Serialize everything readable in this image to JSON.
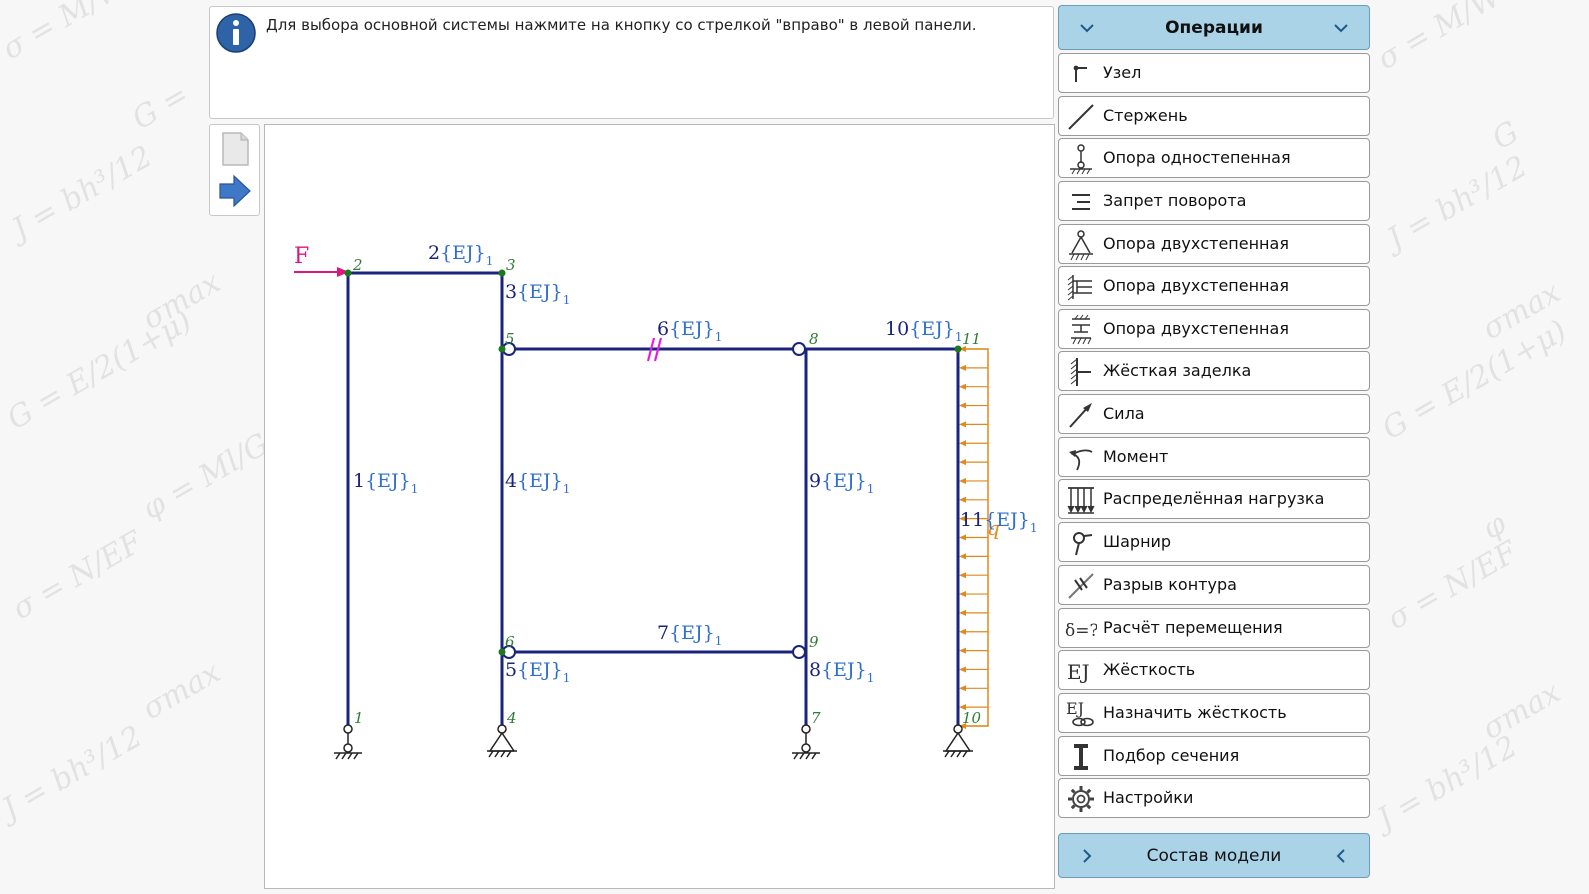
{
  "info": {
    "message": "Для выбора основной системы нажмите на кнопку со стрелкой \"вправо\" в левой панели.",
    "icon": "info-icon"
  },
  "tools": [
    {
      "icon": "new-document-icon"
    },
    {
      "icon": "arrow-right-icon"
    }
  ],
  "operations": {
    "header": "Операции",
    "items": [
      {
        "label": "Узел",
        "icon": "node-icon"
      },
      {
        "label": "Стержень",
        "icon": "rod-icon"
      },
      {
        "label": "Опора одностепенная",
        "icon": "support-single-icon"
      },
      {
        "label": "Запрет поворота",
        "icon": "rotation-lock-icon"
      },
      {
        "label": "Опора двухстепенная",
        "icon": "support-pin-icon"
      },
      {
        "label": "Опора двухстепенная",
        "icon": "support-wall-icon"
      },
      {
        "label": "Опора двухстепенная",
        "icon": "support-slide-icon"
      },
      {
        "label": "Жёсткая заделка",
        "icon": "fixed-support-icon"
      },
      {
        "label": "Сила",
        "icon": "force-icon"
      },
      {
        "label": "Момент",
        "icon": "moment-icon"
      },
      {
        "label": "Распределённая нагрузка",
        "icon": "distributed-load-icon"
      },
      {
        "label": "Шарнир",
        "icon": "hinge-icon"
      },
      {
        "label": "Разрыв контура",
        "icon": "contour-break-icon"
      },
      {
        "label": "Расчёт перемещения",
        "icon": "displacement-icon"
      },
      {
        "label": "Жёсткость",
        "icon": "stiffness-icon"
      },
      {
        "label": "Назначить жёсткость",
        "icon": "assign-stiffness-icon"
      },
      {
        "label": "Подбор сечения",
        "icon": "section-icon"
      },
      {
        "label": "Настройки",
        "icon": "gear-icon"
      }
    ]
  },
  "model": {
    "header": "Состав модели"
  },
  "diagram": {
    "force_label": "F",
    "load_label": "q",
    "colors": {
      "rod": "#1a237e",
      "force": "#e0147a",
      "load": "#e08a1e",
      "node": "#1b7a1b",
      "break": "#e020e0",
      "stiffness": "#2f6fd0",
      "node_label": "#2e7d32"
    },
    "nodes": [
      "1",
      "2",
      "3",
      "4",
      "5",
      "6",
      "7",
      "8",
      "9",
      "10",
      "11"
    ],
    "rods": [
      {
        "number": "1",
        "stiffness": "{EJ}",
        "index": "1"
      },
      {
        "number": "2",
        "stiffness": "{EJ}",
        "index": "1"
      },
      {
        "number": "3",
        "stiffness": "{EJ}",
        "index": "1"
      },
      {
        "number": "4",
        "stiffness": "{EJ}",
        "index": "1"
      },
      {
        "number": "5",
        "stiffness": "{EJ}",
        "index": "1"
      },
      {
        "number": "6",
        "stiffness": "{EJ}",
        "index": "1"
      },
      {
        "number": "7",
        "stiffness": "{EJ}",
        "index": "1"
      },
      {
        "number": "8",
        "stiffness": "{EJ}",
        "index": "1"
      },
      {
        "number": "9",
        "stiffness": "{EJ}",
        "index": "1"
      },
      {
        "number": "10",
        "stiffness": "{EJ}",
        "index": "1"
      },
      {
        "number": "11",
        "stiffness": "{EJ}",
        "index": "1"
      }
    ]
  }
}
